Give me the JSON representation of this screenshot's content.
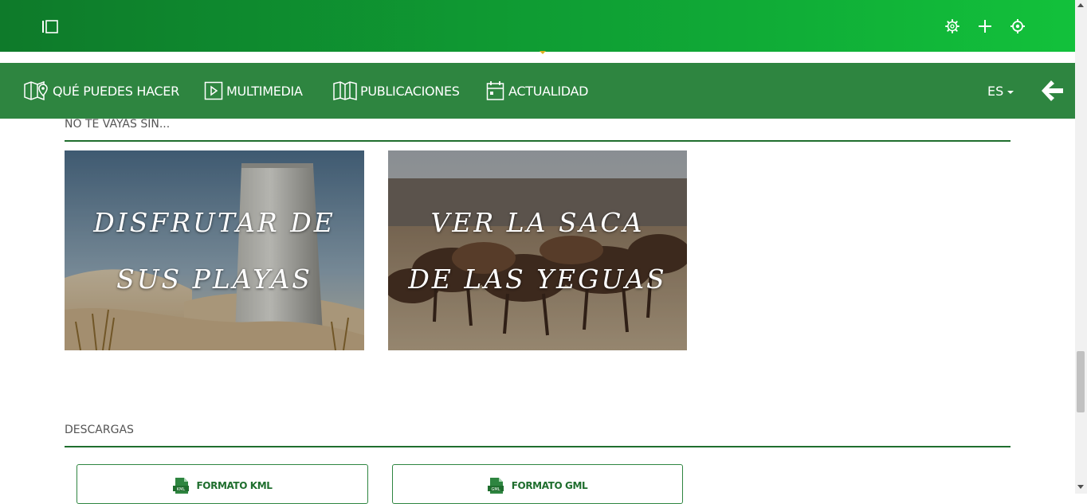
{
  "topbar": {
    "icons": [
      "sidebar-toggle-icon",
      "gear-icon",
      "plus-icon",
      "crosshair-icon"
    ]
  },
  "nav": {
    "items": [
      {
        "label": "QUÉ PUEDES HACER",
        "icon": "map-pin-icon"
      },
      {
        "label": "MULTIMEDIA",
        "icon": "play-icon"
      },
      {
        "label": "PUBLICACIONES",
        "icon": "book-icon"
      },
      {
        "label": "ACTUALIDAD",
        "icon": "calendar-icon"
      }
    ],
    "language": "ES",
    "back_icon": "arrow-left-icon"
  },
  "no_te_vayas": {
    "title": "NO TE VAYAS SIN...",
    "cards": [
      {
        "caption": "DISFRUTAR DE SUS PLAYAS",
        "image": "beach-tower-photo"
      },
      {
        "caption": "VER LA SACA DE LAS YEGUAS",
        "image": "horses-crowd-photo"
      }
    ]
  },
  "descargas": {
    "title": "DESCARGAS",
    "buttons": [
      {
        "label": "FORMATO KML",
        "icon_text": "KML"
      },
      {
        "label": "FORMATO GML",
        "icon_text": "GML"
      }
    ]
  },
  "colors": {
    "topbar_start": "#0e7a2a",
    "topbar_end": "#12c13b",
    "navbar": "#2e8540",
    "accent": "#1f6e2e"
  }
}
